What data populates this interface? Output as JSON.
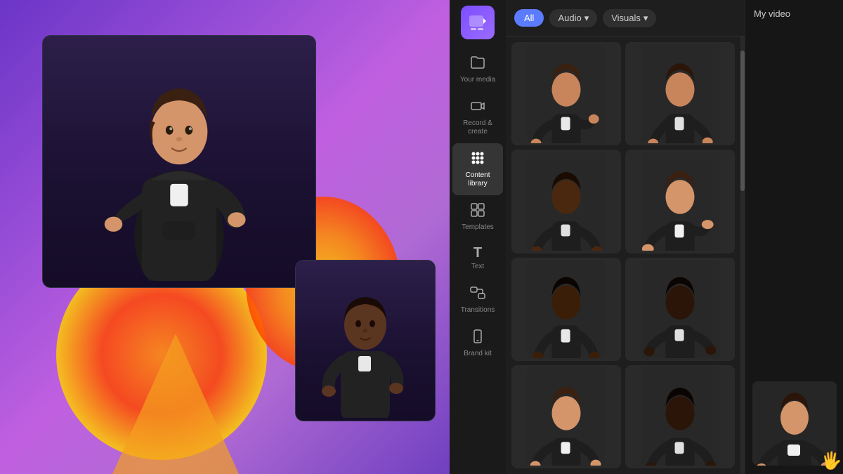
{
  "background": {
    "gradient": "purple to pink"
  },
  "sidebar": {
    "logo_icon": "🎬",
    "items": [
      {
        "id": "your-media",
        "label": "Your media",
        "icon": "folder",
        "active": false
      },
      {
        "id": "record-create",
        "label": "Record &\ncreate",
        "icon": "video",
        "active": false
      },
      {
        "id": "content-library",
        "label": "Content\nlibrary",
        "icon": "apps",
        "active": true
      },
      {
        "id": "templates",
        "label": "Templates",
        "icon": "grid",
        "active": false
      },
      {
        "id": "text",
        "label": "Text",
        "icon": "T",
        "active": false
      },
      {
        "id": "transitions",
        "label": "Transitions",
        "icon": "arrows",
        "active": false
      },
      {
        "id": "brand-kit",
        "label": "Brand kit",
        "icon": "phone",
        "active": false
      }
    ]
  },
  "topbar": {
    "filters": [
      {
        "label": "All",
        "active": true
      },
      {
        "label": "Audio",
        "active": false,
        "has_dropdown": true
      },
      {
        "label": "Visuals",
        "active": false,
        "has_dropdown": true
      }
    ]
  },
  "grid": {
    "thumbnails": [
      {
        "id": "thumb-1",
        "description": "avatar gesturing up"
      },
      {
        "id": "thumb-2",
        "description": "avatar gesturing"
      },
      {
        "id": "thumb-3",
        "description": "avatar dark gesturing"
      },
      {
        "id": "thumb-4",
        "description": "avatar light gesturing"
      },
      {
        "id": "thumb-5",
        "description": "avatar dark standing"
      },
      {
        "id": "thumb-6",
        "description": "avatar dark hands"
      },
      {
        "id": "thumb-7",
        "description": "avatar brown hair"
      },
      {
        "id": "thumb-8",
        "description": "avatar dark hands down"
      }
    ]
  },
  "mini_panel": {
    "title": "My video",
    "thumbnail": {
      "description": "avatar signing"
    }
  },
  "main_view": {
    "large_card": {
      "description": "3D avatar in hoodie gesturing"
    },
    "small_card": {
      "description": "3D avatar dark skin"
    }
  }
}
